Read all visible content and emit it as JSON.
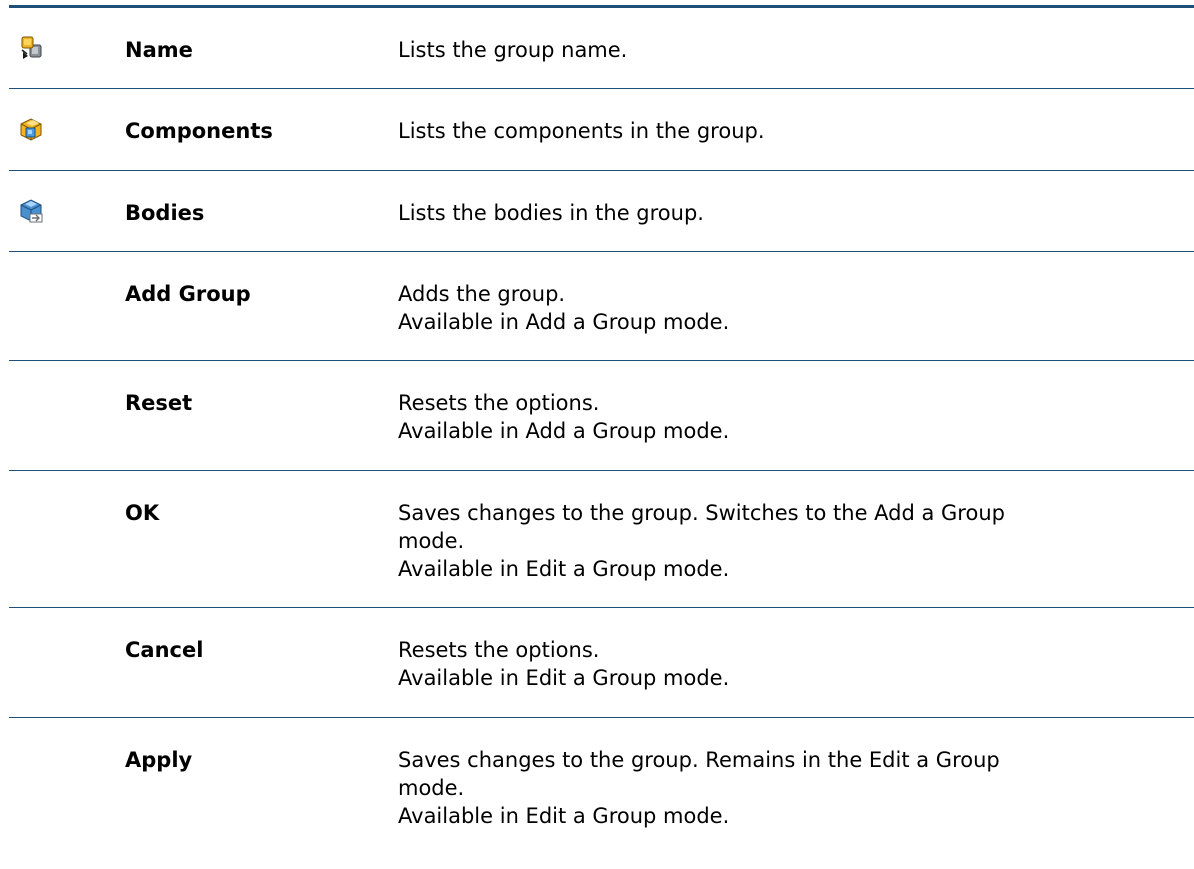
{
  "rows": [
    {
      "icon": "group-name-icon",
      "term": "Name",
      "lines": [
        "Lists the group name."
      ]
    },
    {
      "icon": "components-icon",
      "term": "Components",
      "lines": [
        "Lists the components in the group."
      ]
    },
    {
      "icon": "bodies-icon",
      "term": "Bodies",
      "lines": [
        "Lists the bodies in the group."
      ]
    },
    {
      "icon": "",
      "term": "Add Group",
      "lines": [
        "Adds the group.",
        "Available in Add a Group mode."
      ]
    },
    {
      "icon": "",
      "term": "Reset",
      "lines": [
        "Resets the options.",
        "Available in Add a Group mode."
      ]
    },
    {
      "icon": "",
      "term": "OK",
      "lines": [
        "Saves changes to the group. Switches to the Add a Group",
        "mode.",
        "Available in Edit a Group mode."
      ]
    },
    {
      "icon": "",
      "term": "Cancel",
      "lines": [
        "Resets the options.",
        "Available in Edit a Group mode."
      ]
    },
    {
      "icon": "",
      "term": "Apply",
      "lines": [
        "Saves changes to the group. Remains in the Edit a Group",
        "mode.",
        "Available in Edit a Group mode."
      ]
    }
  ],
  "colors": {
    "rule": "#1f4e79",
    "text": "#000000"
  }
}
